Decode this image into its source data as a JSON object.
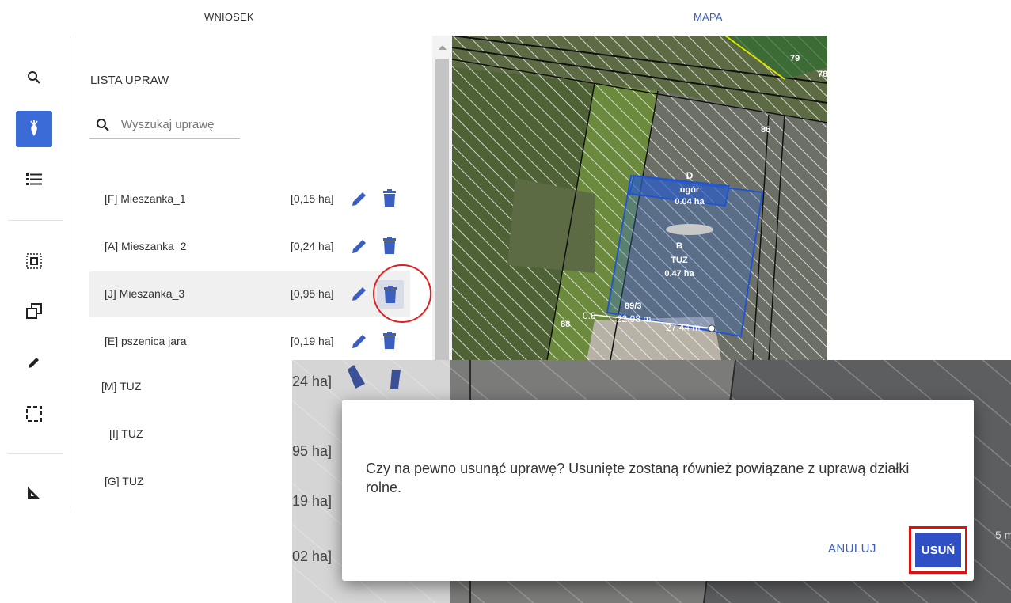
{
  "tabs": {
    "wniosek": "WNIOSEK",
    "mapa": "MAPA"
  },
  "toolbar": {
    "icons": [
      "search-icon",
      "crop-icon",
      "list-icon",
      "select-area-icon",
      "copy-icon",
      "pencil-icon",
      "selection-icon",
      "measure-icon"
    ],
    "active": "crop-icon"
  },
  "panel": {
    "title": "LISTA UPRAW",
    "search_placeholder": "Wyszukaj uprawę",
    "rows": [
      {
        "name": "[F] Mieszanka_1",
        "area": "[0,15 ha]"
      },
      {
        "name": "[A] Mieszanka_2",
        "area": "[0,24 ha]"
      },
      {
        "name": "[J] Mieszanka_3",
        "area": "[0,95 ha]",
        "selected": true
      },
      {
        "name": "[E] pszenica jara",
        "area": "[0,19 ha]"
      },
      {
        "name": "[M] TUZ",
        "area": "24 ha]"
      },
      {
        "name": "[I] TUZ",
        "area": "95 ha]"
      },
      {
        "name": "[G] TUZ",
        "area": "19 ha]"
      },
      {
        "name": "",
        "area": "02 ha]"
      }
    ]
  },
  "map": {
    "parcel_labels": [
      "D",
      "ugór",
      "0.04 ha",
      "B",
      "TUZ",
      "0.47 ha",
      "86",
      "88",
      "89/3",
      "78",
      "79"
    ],
    "measure_1": "22.98 m",
    "measure_2": "27.44 m",
    "measure_prefix": "0.8",
    "measure_right": "5 m"
  },
  "dialog": {
    "message": "Czy na pewno usunąć uprawę? Usunięte zostaną również powiązane z uprawą działki rolne.",
    "cancel_label": "ANULUJ",
    "delete_label": "USUŃ"
  },
  "colors": {
    "accent": "#2f4fc6",
    "highlight": "#e01010"
  }
}
